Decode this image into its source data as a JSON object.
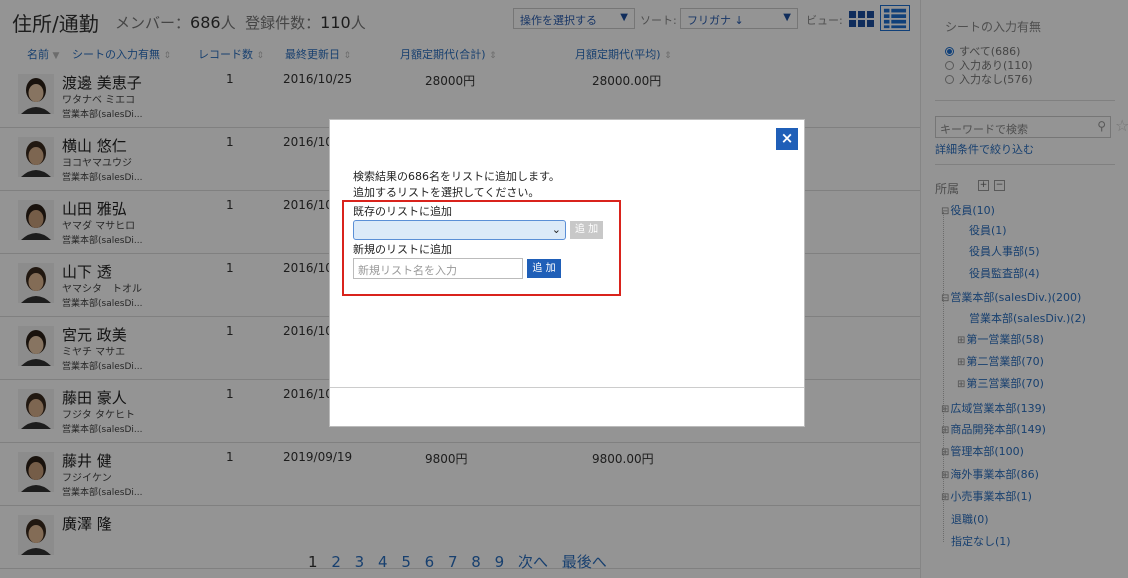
{
  "header": {
    "title": "住所/通勤",
    "member_label": "メンバー：",
    "member_count": "686",
    "member_unit": "人",
    "registered_label": "登録件数：",
    "registered_count": "110",
    "registered_unit": "人",
    "operation_select": "操作を選択する",
    "sort_label": "ソート:",
    "sort_select": "フリガナ ↓",
    "view_label": "ビュー:"
  },
  "columns": {
    "name": "名前",
    "input_status": "シートの入力有無",
    "record_count": "レコード数",
    "last_updated": "最終更新日",
    "commute_total": "月額定期代(合計)",
    "commute_avg": "月額定期代(平均)"
  },
  "rows": [
    {
      "name": "渡邊 美恵子",
      "kana": "ワタナベ ミエコ",
      "dept": "営業本部(salesDi...",
      "records": "1",
      "updated": "2016/10/25",
      "total": "28000円",
      "avg": "28000.00円"
    },
    {
      "name": "横山 悠仁",
      "kana": "ヨコヤマユウジ",
      "dept": "営業本部(salesDi...",
      "records": "1",
      "updated": "2016/10",
      "total": "",
      "avg": ""
    },
    {
      "name": "山田 雅弘",
      "kana": "ヤマダ マサヒロ",
      "dept": "営業本部(salesDi...",
      "records": "1",
      "updated": "2016/10",
      "total": "",
      "avg": ""
    },
    {
      "name": "山下 透",
      "kana": "ヤマシタ　トオル",
      "dept": "営業本部(salesDi...",
      "records": "1",
      "updated": "2016/10",
      "total": "",
      "avg": ""
    },
    {
      "name": "宮元 政美",
      "kana": "ミヤチ マサエ",
      "dept": "営業本部(salesDi...",
      "records": "1",
      "updated": "2016/10",
      "total": "",
      "avg": ""
    },
    {
      "name": "藤田 豪人",
      "kana": "フジタ タケヒト",
      "dept": "営業本部(salesDi...",
      "records": "1",
      "updated": "2016/10",
      "total": "",
      "avg": ""
    },
    {
      "name": "藤井 健",
      "kana": "フジイケン",
      "dept": "営業本部(salesDi...",
      "records": "1",
      "updated": "2019/09/19",
      "total": "9800円",
      "avg": "9800.00円"
    },
    {
      "name": "廣澤 隆",
      "kana": "",
      "dept": "",
      "records": "",
      "updated": "",
      "total": "",
      "avg": ""
    }
  ],
  "pager": {
    "pages": [
      "1",
      "2",
      "3",
      "4",
      "5",
      "6",
      "7",
      "8",
      "9"
    ],
    "current": "1",
    "next": "次へ",
    "last": "最後へ"
  },
  "sidebar": {
    "filter_title": "シートの入力有無",
    "options": [
      "すべて(686)",
      "入力あり(110)",
      "入力なし(576)"
    ],
    "search_placeholder": "キーワードで検索",
    "detail_link": "詳細条件で絞り込む",
    "org_title": "所属",
    "tree": [
      "役員(10)",
      "役員(1)",
      "役員人事部(5)",
      "役員監査部(4)",
      "営業本部(salesDiv.)(200)",
      "営業本部(salesDiv.)(2)",
      "第一営業部(58)",
      "第二営業部(70)",
      "第三営業部(70)",
      "広域営業本部(139)",
      "商品開発本部(149)",
      "管理本部(100)",
      "海外事業本部(86)",
      "小売事業本部(1)",
      "退職(0)",
      "指定なし(1)"
    ]
  },
  "modal": {
    "close": "×",
    "message1": "検索結果の686名をリストに追加します。",
    "message2": "追加するリストを選択してください。",
    "existing_label": "既存のリストに追加",
    "existing_add": "追 加",
    "new_label": "新規のリストに追加",
    "new_placeholder": "新規リスト名を入力",
    "new_add": "追 加"
  },
  "colors": {
    "accent": "#1f5fb8",
    "highlight_border": "#d9231c",
    "link": "#2a6fc0"
  }
}
